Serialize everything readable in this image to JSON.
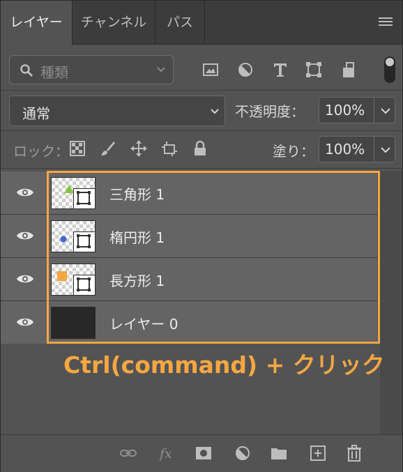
{
  "tabs": [
    {
      "label": "レイヤー",
      "active": true
    },
    {
      "label": "チャンネル",
      "active": false
    },
    {
      "label": "パス",
      "active": false
    }
  ],
  "filter": {
    "placeholder": "種類",
    "icons": [
      "image-filter-icon",
      "adjustment-filter-icon",
      "type-filter-icon",
      "shape-filter-icon",
      "smart-object-filter-icon"
    ]
  },
  "blend": {
    "mode": "通常",
    "opacity_label": "不透明度：",
    "opacity_value": "100%"
  },
  "lock": {
    "label": "ロック：",
    "fill_label": "塗り：",
    "fill_value": "100%"
  },
  "layers": [
    {
      "name": "三角形 1",
      "shape_color": "#8bc34a",
      "shape": "triangle"
    },
    {
      "name": "楕円形 1",
      "shape_color": "#3f6bd0",
      "shape": "ellipse"
    },
    {
      "name": "長方形 1",
      "shape_color": "#f5a742",
      "shape": "rectangle"
    },
    {
      "name": "レイヤー 0",
      "shape_color": "#282828",
      "shape": "fill"
    }
  ],
  "caption": "Ctrl(command) + クリック",
  "footer_icons": [
    "link-icon",
    "fx-icon",
    "mask-icon",
    "adjustment-icon",
    "folder-icon",
    "new-layer-icon",
    "trash-icon"
  ],
  "colors": {
    "highlight": "#f5a742",
    "panel": "#535353",
    "layer_row": "#646464"
  }
}
